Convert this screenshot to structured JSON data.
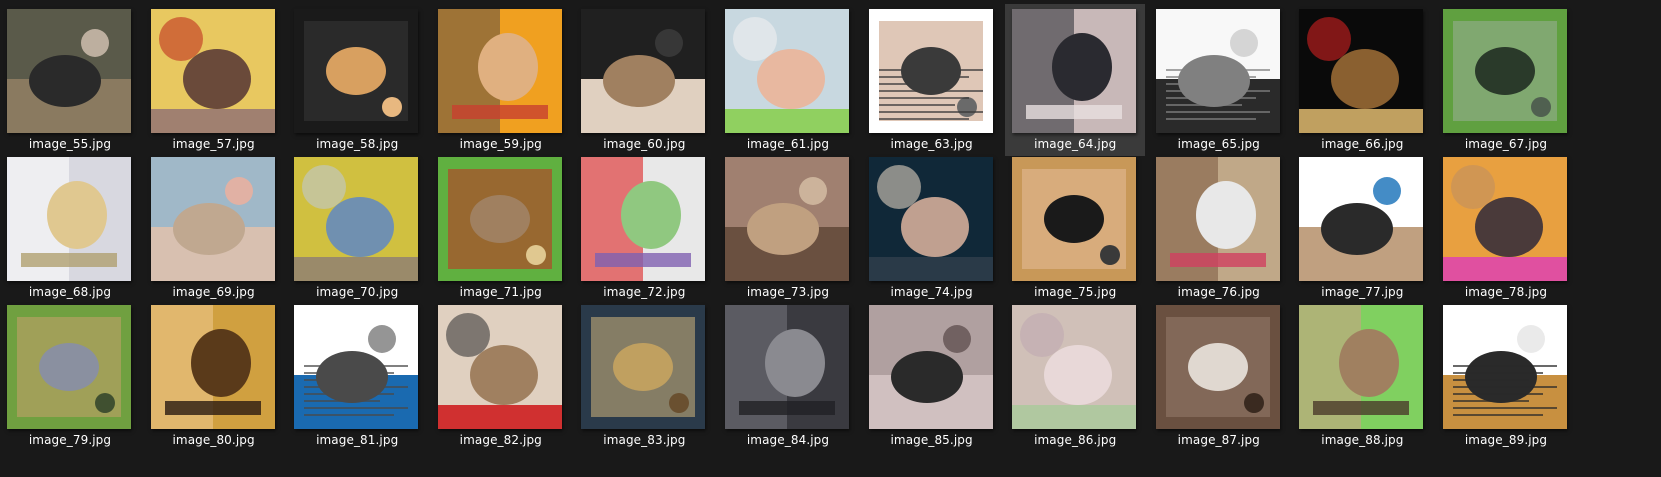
{
  "window": {
    "view": "large-icons"
  },
  "selected_index": 7,
  "files": [
    {
      "name": "image_55.jpg",
      "subject": "person-with-pigs-on-farm",
      "palette": [
        "#5a5a4a",
        "#2a2a2a",
        "#8a7a60",
        "#c8b8a8"
      ]
    },
    {
      "name": "image_57.jpg",
      "subject": "hamster-on-rock",
      "palette": [
        "#e8c860",
        "#6a4a3a",
        "#a08070",
        "#c03020"
      ]
    },
    {
      "name": "image_58.jpg",
      "subject": "fluffy-hamster",
      "palette": [
        "#1a1a1a",
        "#d8a060",
        "#3a3a3a",
        "#e8b880"
      ]
    },
    {
      "name": "image_59.jpg",
      "subject": "hamster-in-hands",
      "palette": [
        "#f0a020",
        "#e0b080",
        "#7a6040",
        "#c84030"
      ]
    },
    {
      "name": "image_60.jpg",
      "subject": "hamster-on-dark-fabric",
      "palette": [
        "#202020",
        "#a08060",
        "#e0d0c0",
        "#3a3a3a"
      ]
    },
    {
      "name": "image_61.jpg",
      "subject": "green-frog-toy-in-hand",
      "palette": [
        "#c8d8e0",
        "#e8b8a0",
        "#90d060",
        "#f0f0f0"
      ]
    },
    {
      "name": "image_63.jpg",
      "subject": "article-screenshot",
      "palette": [
        "#ffffff",
        "#3a3a3a",
        "#c09070",
        "#6a6a6a"
      ]
    },
    {
      "name": "image_64.jpg",
      "subject": "black-hamster-closeup",
      "palette": [
        "#c8b8b8",
        "#2a2a30",
        "#4a4a50",
        "#e8e0e0"
      ]
    },
    {
      "name": "image_65.jpg",
      "subject": "comic-sketch",
      "palette": [
        "#f8f8f8",
        "#808080",
        "#2a2a2a",
        "#d0d0d0"
      ]
    },
    {
      "name": "image_66.jpg",
      "subject": "dark-doorway",
      "palette": [
        "#0a0a0a",
        "#8a6030",
        "#c0a060",
        "#d02020"
      ]
    },
    {
      "name": "image_67.jpg",
      "subject": "hamster-in-cage",
      "palette": [
        "#60a040",
        "#2a3a2a",
        "#a0b0a0",
        "#506050"
      ]
    },
    {
      "name": "image_68.jpg",
      "subject": "hamster-on-wooden-bridge",
      "palette": [
        "#d8d8e0",
        "#e0c890",
        "#f8f8f8",
        "#b0a070"
      ]
    },
    {
      "name": "image_69.jpg",
      "subject": "standing-hamster",
      "palette": [
        "#a0b8c8",
        "#c0a890",
        "#d8c0b0",
        "#e8b0a0"
      ]
    },
    {
      "name": "image_70.jpg",
      "subject": "hamster-in-yellow-wheel",
      "palette": [
        "#d0c040",
        "#7090b0",
        "#9a8a6a",
        "#c0c8d0"
      ]
    },
    {
      "name": "image_71.jpg",
      "subject": "hamster-in-cage-with-toys",
      "palette": [
        "#60b040",
        "#a08060",
        "#d02020",
        "#e0c890"
      ]
    },
    {
      "name": "image_72.jpg",
      "subject": "hamster-in-teepee",
      "palette": [
        "#e8e8e8",
        "#90c880",
        "#e04040",
        "#8060b0"
      ]
    },
    {
      "name": "image_73.jpg",
      "subject": "hamster-on-bedding",
      "palette": [
        "#a08070",
        "#c0a080",
        "#6a5040",
        "#d0b8a0"
      ]
    },
    {
      "name": "image_74.jpg",
      "subject": "movie-still-man",
      "palette": [
        "#102838",
        "#c0a090",
        "#2a3a48",
        "#e0d0c0"
      ]
    },
    {
      "name": "image_75.jpg",
      "subject": "man-with-headphones-and-cat",
      "palette": [
        "#c89858",
        "#1a1a1a",
        "#e8c0a0",
        "#3a3a3a"
      ]
    },
    {
      "name": "image_76.jpg",
      "subject": "white-hamster-in-bowl",
      "palette": [
        "#c0a888",
        "#e8e8e8",
        "#8a6a50",
        "#d04060"
      ]
    },
    {
      "name": "image_77.jpg",
      "subject": "hamster-cage-from-above",
      "palette": [
        "#ffffff",
        "#2a2a2a",
        "#c0a080",
        "#3080c0"
      ]
    },
    {
      "name": "image_78.jpg",
      "subject": "hamster-on-cage-edge",
      "palette": [
        "#e8a040",
        "#4a3a3a",
        "#e050a0",
        "#c09060"
      ]
    },
    {
      "name": "image_79.jpg",
      "subject": "hamster-in-grass",
      "palette": [
        "#70a040",
        "#8a90a0",
        "#d0a070",
        "#405030"
      ]
    },
    {
      "name": "image_80.jpg",
      "subject": "hamster-reaching",
      "palette": [
        "#d0a040",
        "#5a3a1a",
        "#e8c080",
        "#2a1a10"
      ]
    },
    {
      "name": "image_81.jpg",
      "subject": "social-post-screenshot",
      "palette": [
        "#ffffff",
        "#4a4a4a",
        "#1a6ab0",
        "#8a8a8a"
      ]
    },
    {
      "name": "image_82.jpg",
      "subject": "small-basket-on-floor",
      "palette": [
        "#e0d0c0",
        "#a08060",
        "#d03030",
        "#3a3a3a"
      ]
    },
    {
      "name": "image_83.jpg",
      "subject": "guinea-pig-closeup",
      "palette": [
        "#2a3a4a",
        "#c0a060",
        "#e0c080",
        "#6a5030"
      ]
    },
    {
      "name": "image_84.jpg",
      "subject": "hamster-behind-bars",
      "palette": [
        "#3a3a40",
        "#8a8a90",
        "#6a6a70",
        "#202024"
      ]
    },
    {
      "name": "image_85.jpg",
      "subject": "cage-interior",
      "palette": [
        "#b0a0a0",
        "#2a2a2a",
        "#d0c0c0",
        "#6a5a5a"
      ]
    },
    {
      "name": "image_86.jpg",
      "subject": "baby-hamsters-in-bedding",
      "palette": [
        "#d0c0b8",
        "#e8d8d8",
        "#b0c8a0",
        "#c0a8b0"
      ]
    },
    {
      "name": "image_87.jpg",
      "subject": "hamster-in-cardboard-tube",
      "palette": [
        "#6a5040",
        "#e0d8d0",
        "#9a8070",
        "#3a2a20"
      ]
    },
    {
      "name": "image_88.jpg",
      "subject": "green-hamster-house",
      "palette": [
        "#80d060",
        "#a08060",
        "#c0a880",
        "#4a3a2a"
      ]
    },
    {
      "name": "image_89.jpg",
      "subject": "meme-screenshot",
      "palette": [
        "#ffffff",
        "#2a2a2a",
        "#c89040",
        "#e8e8e8"
      ]
    }
  ]
}
